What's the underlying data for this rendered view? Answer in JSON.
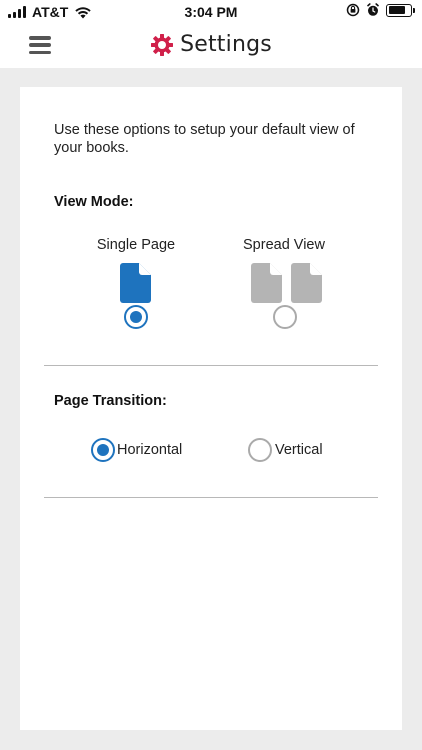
{
  "status_bar": {
    "carrier": "AT&T",
    "time": "3:04 PM",
    "icons": [
      "signal-icon",
      "wifi-icon",
      "orientation-lock-icon",
      "alarm-icon",
      "battery-icon"
    ]
  },
  "header": {
    "title": "Settings",
    "icons": {
      "menu": "hamburger-menu-icon",
      "title": "gear-icon"
    },
    "colors": {
      "gear": "#d0204a",
      "menu": "#555555"
    }
  },
  "settings": {
    "intro": "Use these options to setup your default view of your books.",
    "view_mode": {
      "label": "View Mode:",
      "options": [
        {
          "label": "Single Page",
          "icon": "single-page-icon",
          "selected": true
        },
        {
          "label": "Spread View",
          "icon": "spread-view-icon",
          "selected": false
        }
      ]
    },
    "page_transition": {
      "label": "Page Transition:",
      "options": [
        {
          "label": "Horizontal",
          "selected": true
        },
        {
          "label": "Vertical",
          "selected": false
        }
      ]
    }
  },
  "colors": {
    "accent": "#1e73be",
    "inactive_icon": "#b4b4b4",
    "background": "#ececec"
  }
}
